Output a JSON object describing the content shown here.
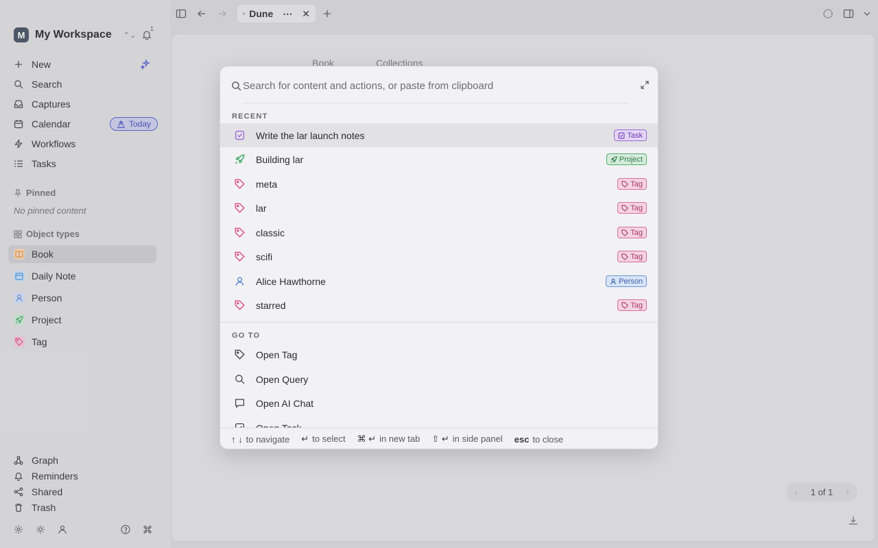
{
  "workspace": {
    "avatar_letter": "M",
    "name": "My Workspace",
    "notif_count": "1"
  },
  "sidebar": {
    "nav": [
      {
        "label": "New",
        "icon": "plus-icon"
      },
      {
        "label": "Search",
        "icon": "search-icon"
      },
      {
        "label": "Captures",
        "icon": "inbox-icon"
      },
      {
        "label": "Calendar",
        "icon": "calendar-icon"
      },
      {
        "label": "Workflows",
        "icon": "bolt-icon"
      },
      {
        "label": "Tasks",
        "icon": "list-icon"
      }
    ],
    "today_badge": "Today",
    "pinned_header": "Pinned",
    "pinned_empty": "No pinned content",
    "object_types_header": "Object types",
    "object_types": [
      {
        "label": "Book",
        "color": "#e8903a"
      },
      {
        "label": "Daily Note",
        "color": "#3a8fd9"
      },
      {
        "label": "Person",
        "color": "#5a84d6"
      },
      {
        "label": "Project",
        "color": "#3aa55f"
      },
      {
        "label": "Tag",
        "color": "#d9487f"
      }
    ],
    "bottom_nav": [
      {
        "label": "Graph",
        "icon": "graph-icon"
      },
      {
        "label": "Reminders",
        "icon": "bell-icon"
      },
      {
        "label": "Shared",
        "icon": "share-icon"
      },
      {
        "label": "Trash",
        "icon": "trash-icon"
      }
    ]
  },
  "topbar": {
    "tab_title": "Dune"
  },
  "background": {
    "type_chip": "Book",
    "collections": "Collections",
    "pager": "1 of 1"
  },
  "palette": {
    "search_placeholder": "Search for content and actions, or paste from clipboard",
    "recent_header": "RECENT",
    "recent": [
      {
        "label": "Write the lar launch notes",
        "kind": "Task"
      },
      {
        "label": "Building lar",
        "kind": "Project"
      },
      {
        "label": "meta",
        "kind": "Tag"
      },
      {
        "label": "lar",
        "kind": "Tag"
      },
      {
        "label": "classic",
        "kind": "Tag"
      },
      {
        "label": "scifi",
        "kind": "Tag"
      },
      {
        "label": "Alice Hawthorne",
        "kind": "Person"
      },
      {
        "label": "starred",
        "kind": "Tag"
      }
    ],
    "goto_header": "GO TO",
    "goto": [
      {
        "label": "Open Tag",
        "icon": "tag-icon"
      },
      {
        "label": "Open Query",
        "icon": "search-icon"
      },
      {
        "label": "Open AI Chat",
        "icon": "chat-icon"
      },
      {
        "label": "Open Task",
        "icon": "checkbox-icon"
      }
    ],
    "footer": [
      {
        "keys": "↑ ↓",
        "text": "to navigate"
      },
      {
        "keys": "↵",
        "text": "to select"
      },
      {
        "keys": "⌘ ↵",
        "text": "in new tab"
      },
      {
        "keys": "⇧ ↵",
        "text": "in side panel"
      },
      {
        "keys": "esc",
        "text": "to close"
      }
    ]
  }
}
